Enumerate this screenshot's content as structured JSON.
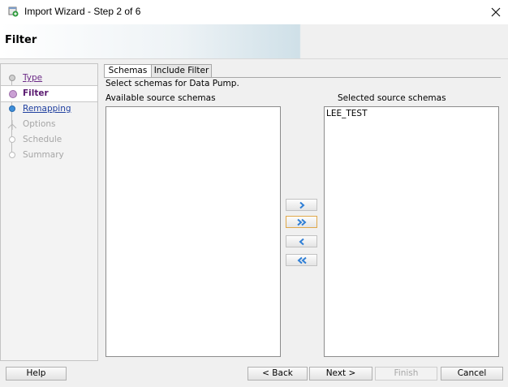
{
  "window": {
    "title": "Import Wizard - Step 2 of 6",
    "close_glyph": "✕"
  },
  "header": {
    "title": "Filter"
  },
  "steps": [
    {
      "label": "Type",
      "state": "visited"
    },
    {
      "label": "Filter",
      "state": "current"
    },
    {
      "label": "Remapping",
      "state": "visited"
    },
    {
      "label": "Options",
      "state": "disabled"
    },
    {
      "label": "Schedule",
      "state": "disabled"
    },
    {
      "label": "Summary",
      "state": "disabled"
    }
  ],
  "tabs": [
    {
      "label": "Schemas",
      "selected": true
    },
    {
      "label": "Include Filter",
      "selected": false
    }
  ],
  "instructions": "Select schemas for Data Pump.",
  "available": {
    "label": "Available source schemas",
    "items": []
  },
  "selected": {
    "label": "Selected source schemas",
    "items": [
      "LEE_TEST"
    ]
  },
  "buttons": {
    "help": "Help",
    "back": "< Back",
    "next": "Next >",
    "finish": "Finish",
    "cancel": "Cancel"
  },
  "colors": {
    "link_visited": "#6b2a86",
    "link": "#1f3f9f",
    "step_current": "#5a1a70",
    "step_disabled": "#a6a6a6",
    "arrow_blue": "#2f7fd6",
    "focus_orange": "#e0a84a"
  },
  "icons": {
    "app": "import-wizard-icon",
    "move_one": "move-right-icon",
    "move_all": "move-all-right-icon",
    "remove_one": "move-left-icon",
    "remove_all": "move-all-left-icon"
  }
}
